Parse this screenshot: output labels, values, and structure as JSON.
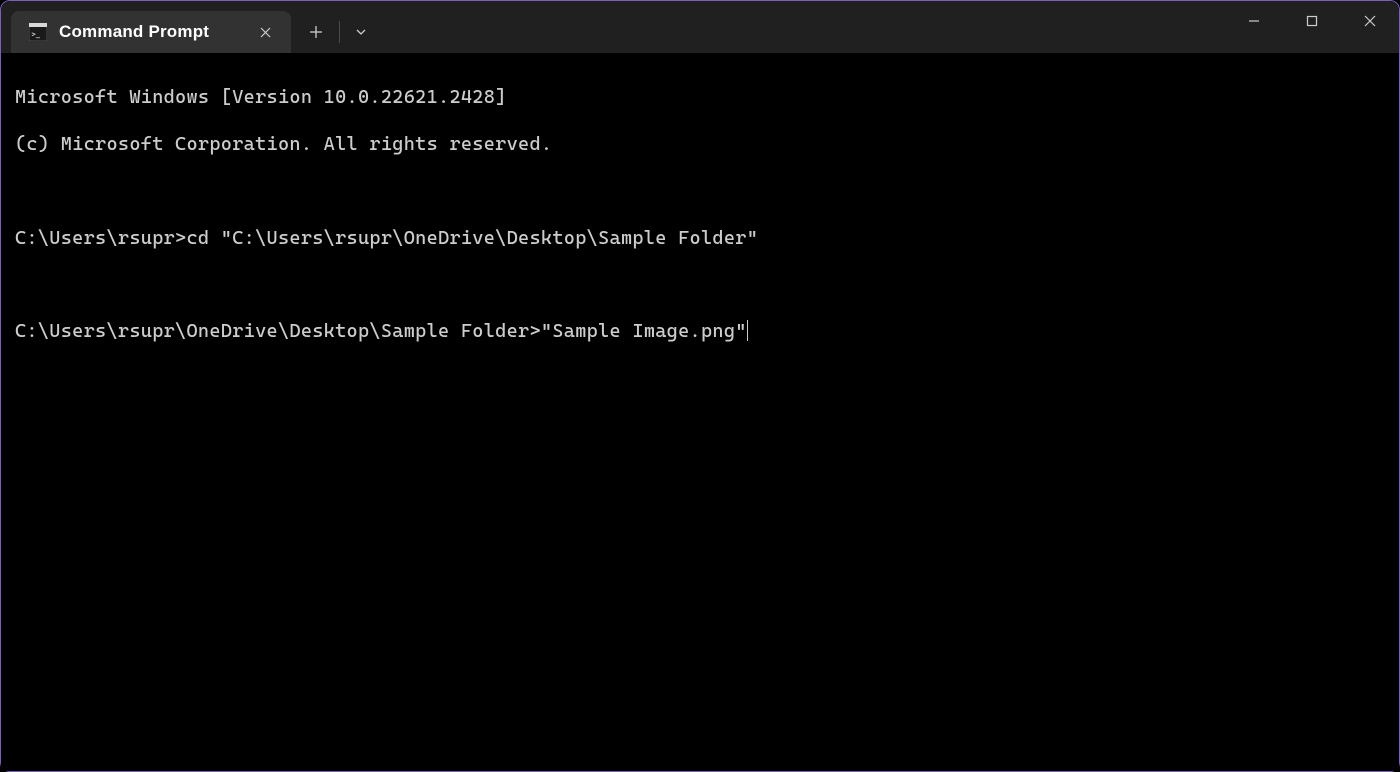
{
  "tab": {
    "title": "Command Prompt"
  },
  "terminal": {
    "line1": "Microsoft Windows [Version 10.0.22621.2428]",
    "line2": "(c) Microsoft Corporation. All rights reserved.",
    "line3": "C:\\Users\\rsupr>cd \"C:\\Users\\rsupr\\OneDrive\\Desktop\\Sample Folder\"",
    "line4_prompt": "C:\\Users\\rsupr\\OneDrive\\Desktop\\Sample Folder>",
    "line4_input": "\"Sample Image.png\""
  }
}
